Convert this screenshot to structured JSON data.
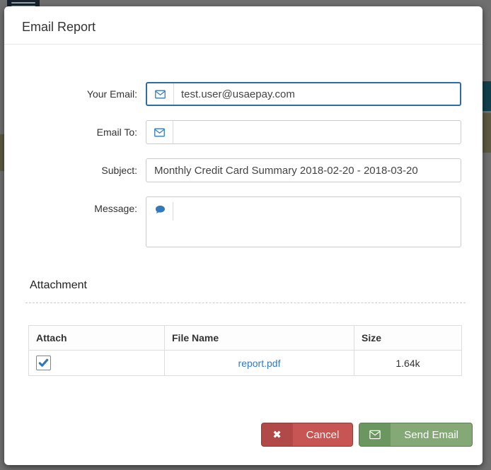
{
  "modal": {
    "title": "Email Report"
  },
  "form": {
    "rows": [
      {
        "label": "Your Email:",
        "value": "test.user@usaepay.com",
        "icon": "envelope-icon",
        "focused": true
      },
      {
        "label": "Email To:",
        "value": "",
        "icon": "envelope-icon",
        "focused": false
      },
      {
        "label": "Subject:",
        "value": "Monthly Credit Card Summary 2018-02-20 - 2018-03-20"
      },
      {
        "label": "Message:",
        "value": "",
        "icon": "comment-icon"
      }
    ]
  },
  "attachment": {
    "heading": "Attachment",
    "table": {
      "headers": [
        "Attach",
        "File Name",
        "Size"
      ],
      "rows": [
        {
          "attached": true,
          "file_name": "report.pdf",
          "size": "1.64k"
        }
      ]
    }
  },
  "footer": {
    "cancel_label": "Cancel",
    "send_label": "Send Email"
  },
  "colors": {
    "focus_blue": "#2e6da4",
    "icon_blue": "#337ab7",
    "link_blue": "#337ab7",
    "cancel_red": "#c65553",
    "cancel_red_dark": "#b04947",
    "send_green": "#84a977",
    "send_green_dark": "#6b9660",
    "backdrop_gray": "#6f6f6f"
  }
}
